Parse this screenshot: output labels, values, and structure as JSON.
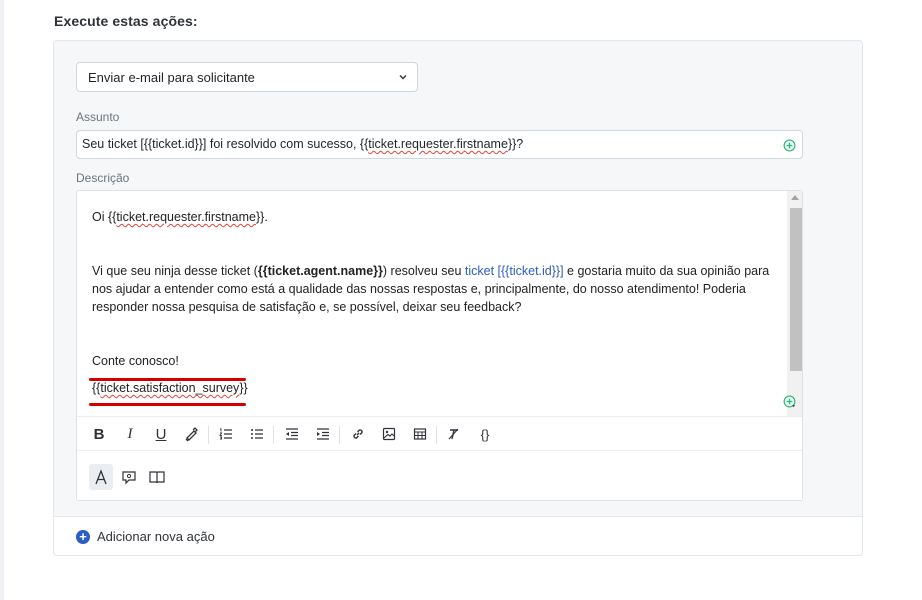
{
  "section": {
    "title": "Execute estas ações:"
  },
  "action": {
    "selected": "Enviar e-mail para solicitante"
  },
  "subject": {
    "label": "Assunto",
    "pre": "Seu ticket [{{ticket.id}}] foi resolvido com sucesso, {{",
    "squiggly": "ticket.requester.firstname",
    "post": "}}?"
  },
  "description": {
    "label": "Descrição",
    "greeting_pre": "Oi {{",
    "greeting_var": "ticket.requester.firstname",
    "greeting_post": "}}.",
    "p2_a": "Vi que seu ninja desse ticket (",
    "p2_bold": "{{ticket.agent.name}}",
    "p2_b": ") resolveu seu ",
    "p2_link": "ticket [{{ticket.id}}]",
    "p2_c": " e gostaria muito da sua opinião para nos ajudar a entender como está a qualidade das nossas respostas e, principalmente, do nosso atendimento! Poderia responder nossa pesquisa de satisfação e, se possível, deixar seu feedback?",
    "closing": "Conte conosco!",
    "survey_pre": "{{",
    "survey_var": "ticket.satisfaction_survey",
    "survey_post": "}}"
  },
  "toolbar": {
    "bold": "B",
    "italic": "I",
    "underline": "U",
    "code": "{}"
  },
  "footer": {
    "add_action": "Adicionar nova ação",
    "add_symbol": "+"
  },
  "colors": {
    "accent": "#2c5cc5",
    "annotation": "#d40000",
    "plus": "#2fb67c"
  }
}
